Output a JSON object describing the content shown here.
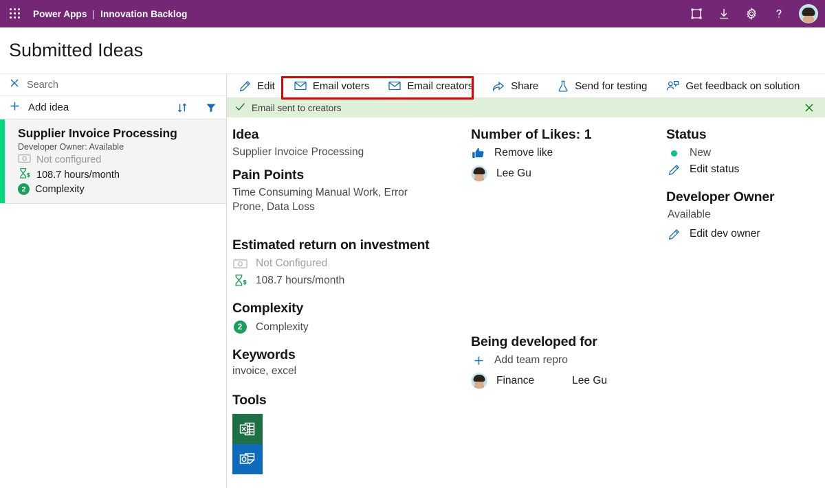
{
  "header": {
    "waffle_icon": "app-launcher-icon",
    "app_name": "Power Apps",
    "separator": "|",
    "environment": "Innovation Backlog",
    "icons": [
      {
        "name": "fit-to-screen-icon",
        "title": "Fit to screen"
      },
      {
        "name": "download-icon",
        "title": "Download"
      },
      {
        "name": "gear-icon",
        "title": "Settings"
      },
      {
        "name": "help-icon",
        "title": "Help"
      }
    ],
    "avatar_name": "user-avatar"
  },
  "page": {
    "title": "Submitted Ideas"
  },
  "sidebar": {
    "search": {
      "placeholder": "Search",
      "clear_icon": "close-icon"
    },
    "add": {
      "label": "Add idea",
      "icon": "plus-icon"
    },
    "sort_icon": "sort-icon",
    "filter_icon": "filter-icon",
    "cards": [
      {
        "title": "Supplier Invoice Processing",
        "owner_line": "Developer Owner: Available",
        "money_label": "Not configured",
        "hours_label": "108.7 hours/month",
        "complexity_badge": "2",
        "complexity_label": "Complexity"
      }
    ]
  },
  "commandbar": {
    "items": [
      {
        "label": "Edit",
        "icon": "pencil-icon"
      },
      {
        "label": "Email voters",
        "icon": "mail-icon"
      },
      {
        "label": "Email creators",
        "icon": "mail-icon"
      },
      {
        "label": "Share",
        "icon": "share-icon"
      },
      {
        "label": "Send for testing",
        "icon": "flask-icon"
      },
      {
        "label": "Get feedback on solution",
        "icon": "person-feedback-icon"
      }
    ],
    "highlight_note": "red-annotation-box"
  },
  "notification": {
    "icon": "checkmark-icon",
    "message": "Email sent to creators",
    "close_icon": "close-icon"
  },
  "detail": {
    "idea": {
      "heading": "Idea",
      "value": "Supplier Invoice Processing"
    },
    "pain_points": {
      "heading": "Pain Points",
      "value": "Time Consuming Manual Work, Error Prone, Data Loss"
    },
    "roi": {
      "heading": "Estimated return on investment",
      "money_label": "Not Configured",
      "money_icon": "money-icon",
      "hours_label": "108.7 hours/month",
      "hours_icon": "hourglass-dollar-icon"
    },
    "complexity": {
      "heading": "Complexity",
      "badge": "2",
      "label": "Complexity"
    },
    "keywords": {
      "heading": "Keywords",
      "value": "invoice, excel"
    },
    "tools": {
      "heading": "Tools",
      "items": [
        {
          "name": "excel-icon",
          "label": "Excel",
          "color": "#1d7044"
        },
        {
          "name": "outlook-icon",
          "label": "Outlook",
          "color": "#0f6cbd"
        }
      ]
    },
    "likes": {
      "heading": "Number of Likes: 1",
      "action_label": "Remove like",
      "action_icon": "thumbs-up-icon",
      "voters": [
        {
          "name": "Lee Gu"
        }
      ]
    },
    "developed_for": {
      "heading": "Being developed for",
      "add_label": "Add team repro",
      "add_icon": "plus-icon",
      "rows": [
        {
          "team": "Finance",
          "person": "Lee Gu"
        }
      ]
    },
    "status": {
      "heading": "Status",
      "value": "New",
      "dot_color": "#00c781",
      "edit_label": "Edit status",
      "edit_icon": "pencil-icon"
    },
    "dev_owner": {
      "heading": "Developer Owner",
      "value": "Available",
      "edit_label": "Edit dev owner",
      "edit_icon": "pencil-icon"
    }
  },
  "colors": {
    "brand_purple": "#742774",
    "accent_green": "#00d77e",
    "link_blue": "#0f6cbd",
    "notif_bg": "#dff0d8",
    "annotation_red": "#e60000"
  }
}
